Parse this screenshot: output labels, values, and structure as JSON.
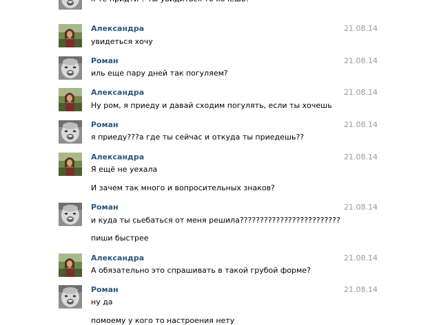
{
  "messages": [
    {
      "author": "",
      "date": "",
      "avatar": "roman-avatar",
      "lines": [
        "к те придти ? ты увидиться то хочешь?"
      ]
    },
    {
      "author": "Александра",
      "date": "21.08.14",
      "avatar": "aleksandra-avatar",
      "lines": [
        "увидеться хочу"
      ]
    },
    {
      "author": "Роман",
      "date": "21.08.14",
      "avatar": "roman-avatar",
      "lines": [
        "иль еще пару дней так погуляем?"
      ]
    },
    {
      "author": "Александра",
      "date": "21.08.14",
      "avatar": "aleksandra-avatar",
      "lines": [
        "Ну ром, я приеду и давай сходим погулять, если ты хочешь"
      ]
    },
    {
      "author": "Роман",
      "date": "21.08.14",
      "avatar": "roman-avatar",
      "lines": [
        "я приеду???а где ты сейчас и откуда ты приедешь??"
      ]
    },
    {
      "author": "Александра",
      "date": "21.08.14",
      "avatar": "aleksandra-avatar",
      "lines": [
        "Я ещё не уехала",
        "И зачем так много и вопросительных знаков?"
      ]
    },
    {
      "author": "Роман",
      "date": "21.08.14",
      "avatar": "roman-avatar",
      "lines": [
        "и куда ты сьебаться от меня решила?????????????????????????",
        "пиши быстрее"
      ]
    },
    {
      "author": "Александра",
      "date": "21.08.14",
      "avatar": "aleksandra-avatar",
      "lines": [
        "А обязательно это спрашивать в такой грубой форме?"
      ]
    },
    {
      "author": "Роман",
      "date": "21.08.14",
      "avatar": "roman-avatar",
      "lines": [
        "ну да",
        "помоему у кого то настроения нету"
      ]
    }
  ]
}
